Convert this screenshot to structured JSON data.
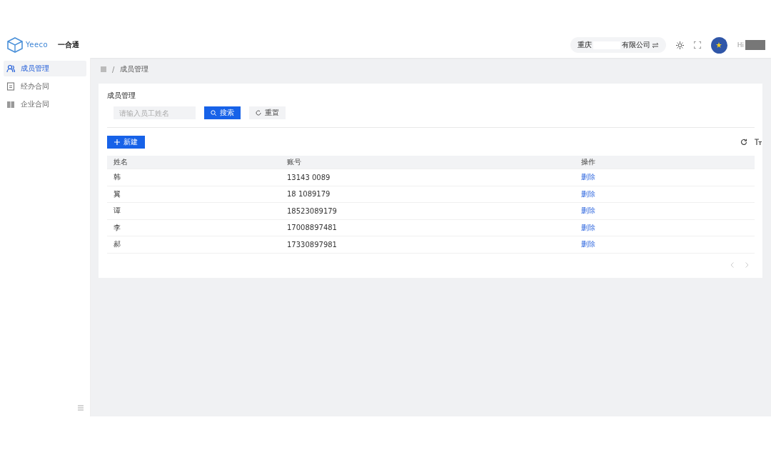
{
  "header": {
    "brand": "Yeeco",
    "app_name": "一合通",
    "company_prefix": "重庆",
    "company_suffix": "有限公司",
    "greeting": "Hi"
  },
  "sidebar": {
    "items": [
      {
        "label": "成员管理",
        "selected": true
      },
      {
        "label": "经办合同",
        "selected": false
      },
      {
        "label": "企业合同",
        "selected": false
      }
    ]
  },
  "breadcrumb": {
    "separator": "/",
    "current": "成员管理"
  },
  "panel": {
    "title": "成员管理",
    "search": {
      "placeholder": "请输入员工姓名"
    },
    "search_button": "搜索",
    "reset_button": "重置",
    "new_button": "新建"
  },
  "table": {
    "columns": [
      "姓名",
      "账号",
      "操作"
    ],
    "rows": [
      {
        "name": "韩",
        "account": "13143 0089",
        "action": "删除"
      },
      {
        "name": "翼",
        "account": "18 1089179",
        "action": "删除"
      },
      {
        "name": "谭",
        "account": "18523089179",
        "action": "删除"
      },
      {
        "name": "李",
        "account": "17008897481",
        "action": "删除"
      },
      {
        "name": "郝",
        "account": "17330897981",
        "action": "删除"
      }
    ]
  }
}
